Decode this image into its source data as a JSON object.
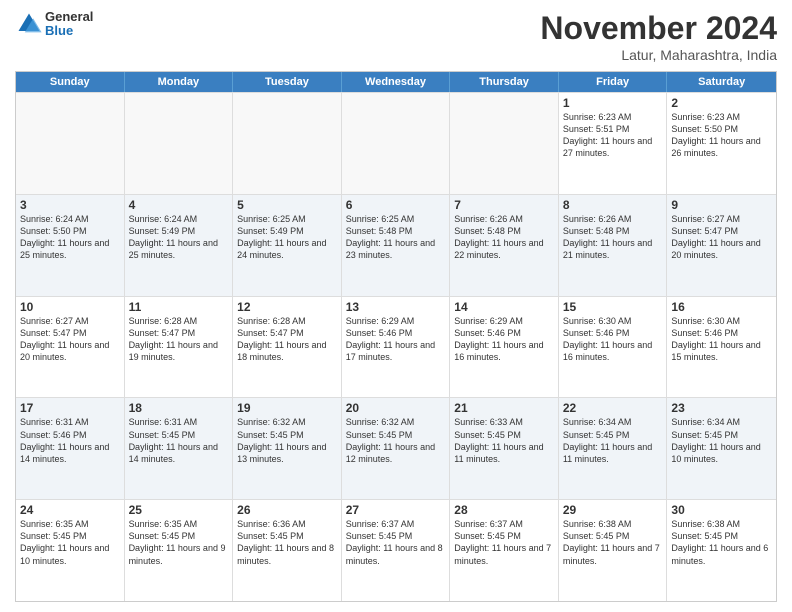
{
  "logo": {
    "general": "General",
    "blue": "Blue"
  },
  "title": "November 2024",
  "location": "Latur, Maharashtra, India",
  "header_days": [
    "Sunday",
    "Monday",
    "Tuesday",
    "Wednesday",
    "Thursday",
    "Friday",
    "Saturday"
  ],
  "rows": [
    [
      {
        "day": "",
        "empty": true,
        "text": ""
      },
      {
        "day": "",
        "empty": true,
        "text": ""
      },
      {
        "day": "",
        "empty": true,
        "text": ""
      },
      {
        "day": "",
        "empty": true,
        "text": ""
      },
      {
        "day": "",
        "empty": true,
        "text": ""
      },
      {
        "day": "1",
        "empty": false,
        "text": "Sunrise: 6:23 AM\nSunset: 5:51 PM\nDaylight: 11 hours and 27 minutes."
      },
      {
        "day": "2",
        "empty": false,
        "text": "Sunrise: 6:23 AM\nSunset: 5:50 PM\nDaylight: 11 hours and 26 minutes."
      }
    ],
    [
      {
        "day": "3",
        "empty": false,
        "text": "Sunrise: 6:24 AM\nSunset: 5:50 PM\nDaylight: 11 hours and 25 minutes."
      },
      {
        "day": "4",
        "empty": false,
        "text": "Sunrise: 6:24 AM\nSunset: 5:49 PM\nDaylight: 11 hours and 25 minutes."
      },
      {
        "day": "5",
        "empty": false,
        "text": "Sunrise: 6:25 AM\nSunset: 5:49 PM\nDaylight: 11 hours and 24 minutes."
      },
      {
        "day": "6",
        "empty": false,
        "text": "Sunrise: 6:25 AM\nSunset: 5:48 PM\nDaylight: 11 hours and 23 minutes."
      },
      {
        "day": "7",
        "empty": false,
        "text": "Sunrise: 6:26 AM\nSunset: 5:48 PM\nDaylight: 11 hours and 22 minutes."
      },
      {
        "day": "8",
        "empty": false,
        "text": "Sunrise: 6:26 AM\nSunset: 5:48 PM\nDaylight: 11 hours and 21 minutes."
      },
      {
        "day": "9",
        "empty": false,
        "text": "Sunrise: 6:27 AM\nSunset: 5:47 PM\nDaylight: 11 hours and 20 minutes."
      }
    ],
    [
      {
        "day": "10",
        "empty": false,
        "text": "Sunrise: 6:27 AM\nSunset: 5:47 PM\nDaylight: 11 hours and 20 minutes."
      },
      {
        "day": "11",
        "empty": false,
        "text": "Sunrise: 6:28 AM\nSunset: 5:47 PM\nDaylight: 11 hours and 19 minutes."
      },
      {
        "day": "12",
        "empty": false,
        "text": "Sunrise: 6:28 AM\nSunset: 5:47 PM\nDaylight: 11 hours and 18 minutes."
      },
      {
        "day": "13",
        "empty": false,
        "text": "Sunrise: 6:29 AM\nSunset: 5:46 PM\nDaylight: 11 hours and 17 minutes."
      },
      {
        "day": "14",
        "empty": false,
        "text": "Sunrise: 6:29 AM\nSunset: 5:46 PM\nDaylight: 11 hours and 16 minutes."
      },
      {
        "day": "15",
        "empty": false,
        "text": "Sunrise: 6:30 AM\nSunset: 5:46 PM\nDaylight: 11 hours and 16 minutes."
      },
      {
        "day": "16",
        "empty": false,
        "text": "Sunrise: 6:30 AM\nSunset: 5:46 PM\nDaylight: 11 hours and 15 minutes."
      }
    ],
    [
      {
        "day": "17",
        "empty": false,
        "text": "Sunrise: 6:31 AM\nSunset: 5:46 PM\nDaylight: 11 hours and 14 minutes."
      },
      {
        "day": "18",
        "empty": false,
        "text": "Sunrise: 6:31 AM\nSunset: 5:45 PM\nDaylight: 11 hours and 14 minutes."
      },
      {
        "day": "19",
        "empty": false,
        "text": "Sunrise: 6:32 AM\nSunset: 5:45 PM\nDaylight: 11 hours and 13 minutes."
      },
      {
        "day": "20",
        "empty": false,
        "text": "Sunrise: 6:32 AM\nSunset: 5:45 PM\nDaylight: 11 hours and 12 minutes."
      },
      {
        "day": "21",
        "empty": false,
        "text": "Sunrise: 6:33 AM\nSunset: 5:45 PM\nDaylight: 11 hours and 11 minutes."
      },
      {
        "day": "22",
        "empty": false,
        "text": "Sunrise: 6:34 AM\nSunset: 5:45 PM\nDaylight: 11 hours and 11 minutes."
      },
      {
        "day": "23",
        "empty": false,
        "text": "Sunrise: 6:34 AM\nSunset: 5:45 PM\nDaylight: 11 hours and 10 minutes."
      }
    ],
    [
      {
        "day": "24",
        "empty": false,
        "text": "Sunrise: 6:35 AM\nSunset: 5:45 PM\nDaylight: 11 hours and 10 minutes."
      },
      {
        "day": "25",
        "empty": false,
        "text": "Sunrise: 6:35 AM\nSunset: 5:45 PM\nDaylight: 11 hours and 9 minutes."
      },
      {
        "day": "26",
        "empty": false,
        "text": "Sunrise: 6:36 AM\nSunset: 5:45 PM\nDaylight: 11 hours and 8 minutes."
      },
      {
        "day": "27",
        "empty": false,
        "text": "Sunrise: 6:37 AM\nSunset: 5:45 PM\nDaylight: 11 hours and 8 minutes."
      },
      {
        "day": "28",
        "empty": false,
        "text": "Sunrise: 6:37 AM\nSunset: 5:45 PM\nDaylight: 11 hours and 7 minutes."
      },
      {
        "day": "29",
        "empty": false,
        "text": "Sunrise: 6:38 AM\nSunset: 5:45 PM\nDaylight: 11 hours and 7 minutes."
      },
      {
        "day": "30",
        "empty": false,
        "text": "Sunrise: 6:38 AM\nSunset: 5:45 PM\nDaylight: 11 hours and 6 minutes."
      }
    ]
  ]
}
